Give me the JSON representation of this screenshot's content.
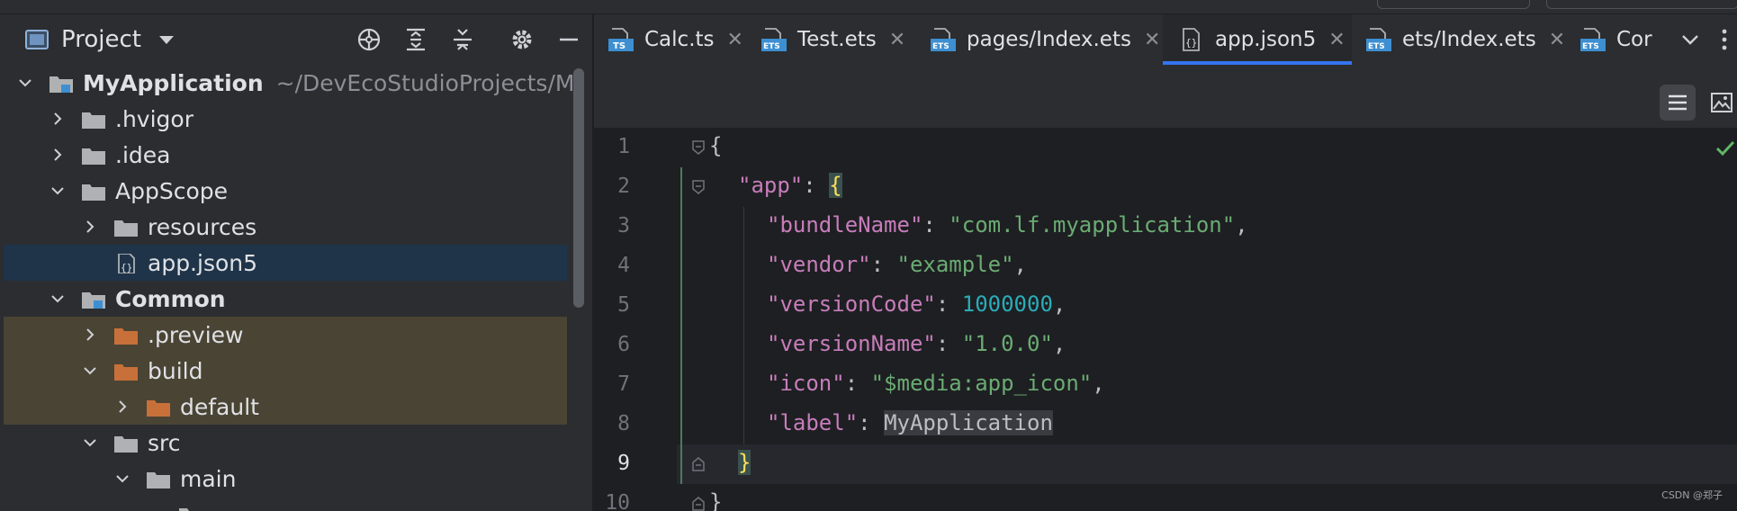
{
  "project_panel": {
    "title": "Project",
    "tree": [
      {
        "label": "MyApplication",
        "path": "~/DevEcoStudioProjects/M",
        "bold": true
      },
      {
        "label": ".hvigor"
      },
      {
        "label": ".idea"
      },
      {
        "label": "AppScope"
      },
      {
        "label": "resources"
      },
      {
        "label": "app.json5"
      },
      {
        "label": "Common",
        "bold": true
      },
      {
        "label": ".preview"
      },
      {
        "label": "build"
      },
      {
        "label": "default"
      },
      {
        "label": "src"
      },
      {
        "label": "main"
      }
    ]
  },
  "tabs": [
    {
      "label": "Calc.ts",
      "type": "TS"
    },
    {
      "label": "Test.ets",
      "type": "ETS"
    },
    {
      "label": "pages/Index.ets",
      "type": "ETS"
    },
    {
      "label": "app.json5",
      "type": "JSON5",
      "active": true
    },
    {
      "label": "ets/Index.ets",
      "type": "ETS"
    },
    {
      "label": "Cor",
      "type": "ETS"
    }
  ],
  "code": {
    "line_numbers": [
      "1",
      "2",
      "3",
      "4",
      "5",
      "6",
      "7",
      "8",
      "9",
      "10"
    ],
    "current_line": 9,
    "app_key": "\"app\"",
    "bundle_key": "\"bundleName\"",
    "bundle_val": "\"com.lf.myapplication\"",
    "vendor_key": "\"vendor\"",
    "vendor_val": "\"example\"",
    "vcode_key": "\"versionCode\"",
    "vcode_val": "1000000",
    "vname_key": "\"versionName\"",
    "vname_val": "\"1.0.0\"",
    "icon_key": "\"icon\"",
    "icon_val": "\"$media:app_icon\"",
    "label_key": "\"label\"",
    "label_val": "MyApplication"
  },
  "watermark": "CSDN @郑子",
  "colors": {
    "accent": "#3574f0",
    "key": "#c77dbb",
    "string": "#6aab73",
    "number": "#2aacb8",
    "selected_row": "#1f3449",
    "excluded_row": "#4a4434",
    "folder_orange": "#c8703a",
    "folder_gray": "#afb1b3"
  }
}
